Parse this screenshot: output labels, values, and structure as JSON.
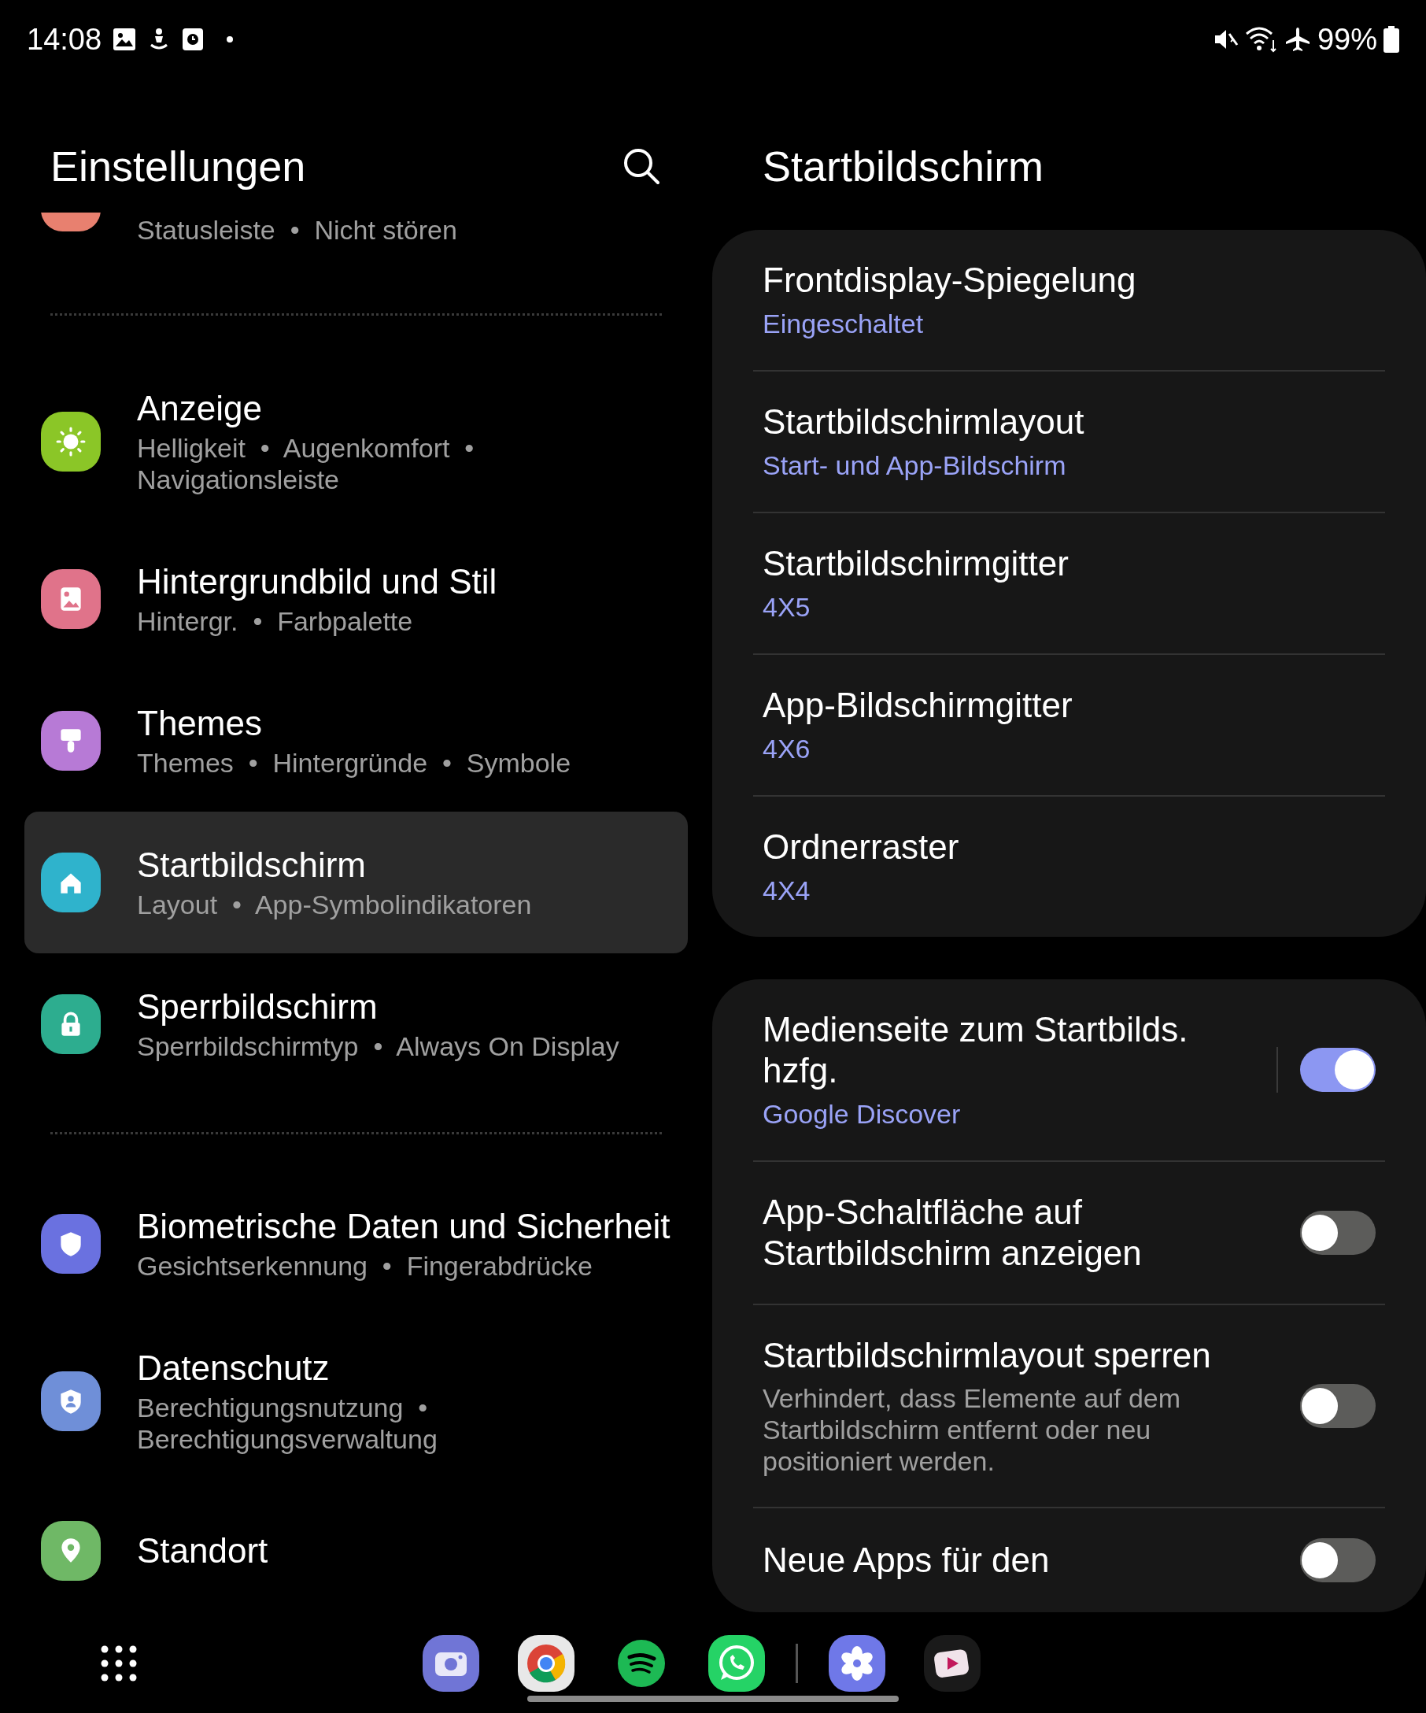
{
  "status_bar": {
    "time": "14:08",
    "battery": "99%"
  },
  "left_panel": {
    "title": "Einstellungen",
    "groups": [
      {
        "items": [
          {
            "kind": "partial",
            "subtitle": "Statusleiste  •  Nicht stören",
            "color": "#e8806f"
          }
        ]
      },
      {
        "items": [
          {
            "kind": "full",
            "title": "Anzeige",
            "subtitle": "Helligkeit  •  Augenkomfort  •  Navigationsleiste",
            "color": "#8bc627",
            "selected": false
          },
          {
            "kind": "full",
            "title": "Hintergrundbild und Stil",
            "subtitle": "Hintergr.  •  Farbpalette",
            "color": "#e0738a",
            "selected": false
          },
          {
            "kind": "full",
            "title": "Themes",
            "subtitle": "Themes  •  Hintergründe  •  Symbole",
            "color": "#b77ad6",
            "selected": false
          },
          {
            "kind": "full",
            "title": "Startbildschirm",
            "subtitle": "Layout  •  App-Symbolindikatoren",
            "color": "#2fb3cc",
            "selected": true
          },
          {
            "kind": "full",
            "title": "Sperrbildschirm",
            "subtitle": "Sperrbildschirmtyp  •  Always On Display",
            "color": "#2dad8f",
            "selected": false
          }
        ]
      },
      {
        "items": [
          {
            "kind": "full",
            "title": "Biometrische Daten und Sicherheit",
            "subtitle": "Gesichtserkennung  •  Fingerabdrücke",
            "color": "#6a71e0",
            "selected": false
          },
          {
            "kind": "full",
            "title": "Datenschutz",
            "subtitle": "Berechtigungsnutzung  •  Berechtigungsverwaltung",
            "color": "#6f8fd8",
            "selected": false
          },
          {
            "kind": "full",
            "title": "Standort",
            "color": "#6fb866",
            "selected": false
          }
        ]
      }
    ]
  },
  "right_panel": {
    "title": "Startbildschirm",
    "cards": [
      {
        "rows": [
          {
            "kind": "link",
            "title": "Frontdisplay-Spiegelung",
            "value": "Eingeschaltet"
          },
          {
            "kind": "link",
            "title": "Startbildschirmlayout",
            "value": "Start- und App-Bildschirm"
          },
          {
            "kind": "link",
            "title": "Startbildschirmgitter",
            "value": "4X5"
          },
          {
            "kind": "link",
            "title": "App-Bildschirmgitter",
            "value": "4X6"
          },
          {
            "kind": "link",
            "title": "Ordnerraster",
            "value": "4X4"
          }
        ]
      },
      {
        "rows": [
          {
            "kind": "switch",
            "title": "Medienseite zum Startbilds. hzfg.",
            "value": "Google Discover",
            "on": true
          },
          {
            "kind": "switch",
            "title": "App-Schaltfläche auf Startbildschirm anzeigen",
            "on": false
          },
          {
            "kind": "switch",
            "title": "Startbildschirmlayout sperren",
            "description": "Verhindert, dass Elemente auf dem Startbildschirm entfernt oder neu positioniert werden.",
            "on": false
          },
          {
            "kind": "switch",
            "title": "Neue Apps für den",
            "on": false
          }
        ]
      }
    ]
  }
}
